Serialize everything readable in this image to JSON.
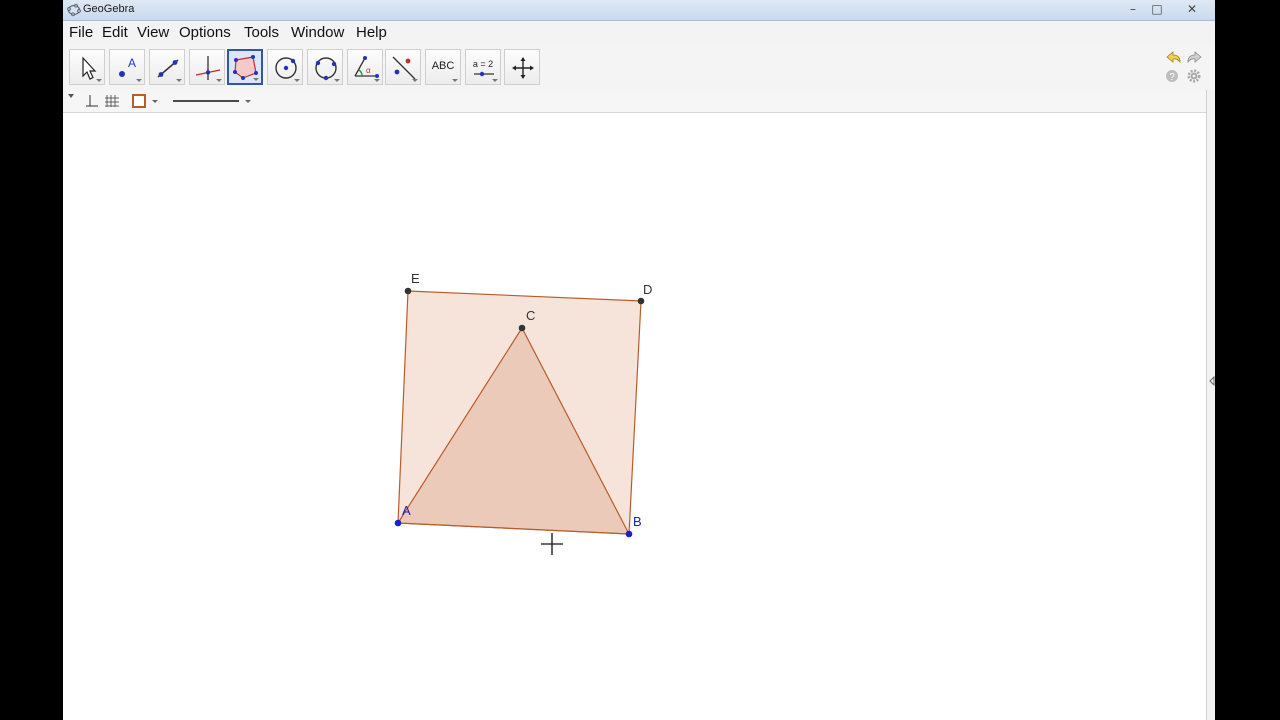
{
  "window": {
    "title": "GeoGebra"
  },
  "window_controls": {
    "minimize": "–",
    "maximize": "□",
    "close": "✕"
  },
  "menu": [
    "File",
    "Edit",
    "View",
    "Options",
    "Tools",
    "Window",
    "Help"
  ],
  "toolbar": {
    "tools": [
      {
        "name": "move-tool",
        "icon": "arrow-cursor-icon"
      },
      {
        "name": "point-tool",
        "icon": "point-icon"
      },
      {
        "name": "line-tool",
        "icon": "line-icon"
      },
      {
        "name": "perpendicular-tool",
        "icon": "perpendicular-icon"
      },
      {
        "name": "polygon-tool",
        "icon": "polygon-icon",
        "selected": true
      },
      {
        "name": "circle-tool",
        "icon": "circle-center-icon"
      },
      {
        "name": "conic-tool",
        "icon": "circle-three-points-icon"
      },
      {
        "name": "angle-tool",
        "icon": "angle-icon"
      },
      {
        "name": "reflect-tool",
        "icon": "reflect-icon"
      },
      {
        "name": "text-tool",
        "icon": "text-icon",
        "label": "ABC"
      },
      {
        "name": "slider-tool",
        "icon": "slider-icon",
        "label": "a = 2"
      },
      {
        "name": "move-graphics-tool",
        "icon": "move-cross-icon"
      }
    ]
  },
  "colors": {
    "fill": "#f2d9cc",
    "triangle_fill": "#e8c2ad",
    "edge": "#b85c2a",
    "free_point": "#1a22c4",
    "dependent_point": "#333333",
    "selected_tool_border": "#3355a8"
  },
  "construction": {
    "points": [
      {
        "name": "A",
        "label_color": "#1a22c4"
      },
      {
        "name": "B",
        "label_color": "#1a22c4"
      },
      {
        "name": "C",
        "label_color": "#333333"
      },
      {
        "name": "D",
        "label_color": "#333333"
      },
      {
        "name": "E",
        "label_color": "#333333"
      }
    ],
    "square": "ABDE",
    "triangle": "ABC"
  }
}
